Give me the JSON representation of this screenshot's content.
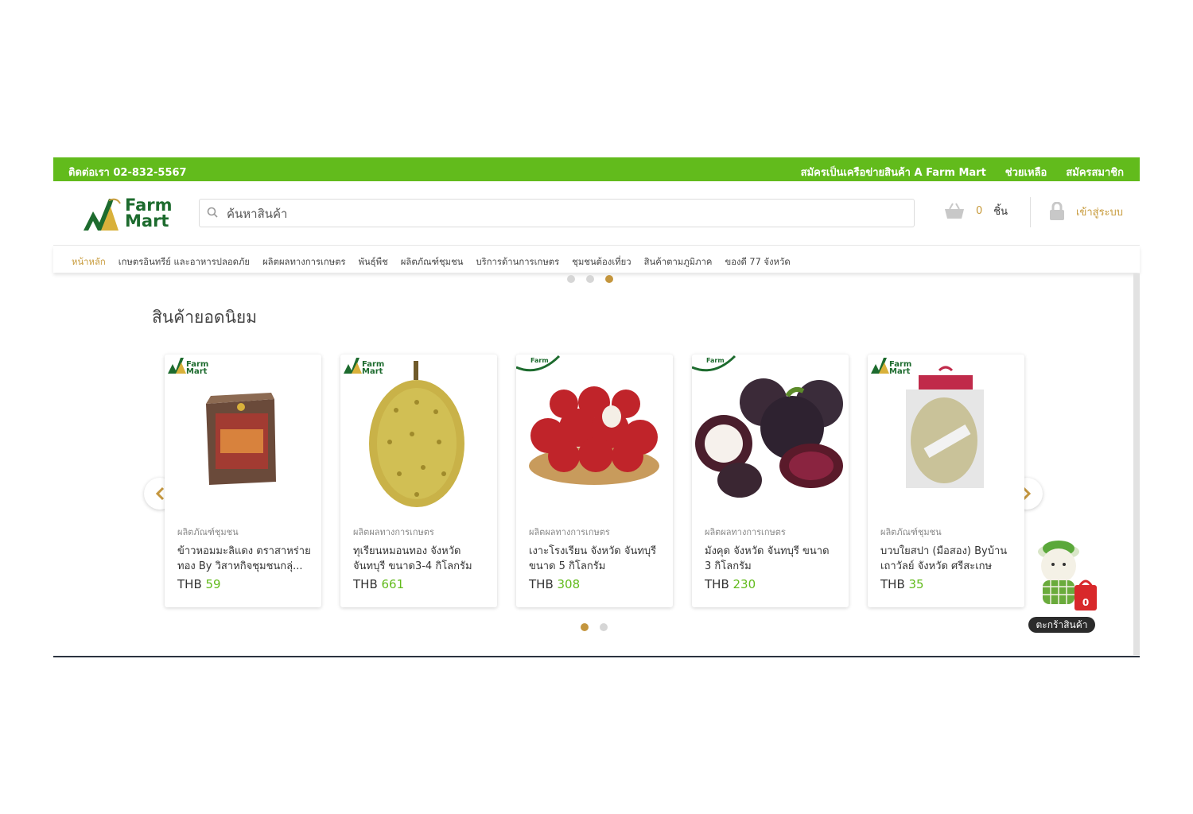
{
  "topbar": {
    "contact": "ติดต่อเรา 02-832-5567",
    "links": [
      "สมัครเป็นเครือข่ายสินค้า A Farm Mart",
      "ช่วยเหลือ",
      "สมัครสมาชิก"
    ]
  },
  "header": {
    "logo_line1": "Farm",
    "logo_line2": "Mart",
    "search_placeholder": "ค้นหาสินค้า",
    "cart_count": "0",
    "cart_unit": "ชิ้น",
    "login_label": "เข้าสู่ระบบ"
  },
  "nav": {
    "items": [
      "หน้าหลัก",
      "เกษตรอินทรีย์ และอาหารปลอดภัย",
      "ผลิตผลทางการเกษตร",
      "พันธุ์พืช",
      "ผลิตภัณฑ์ชุมชน",
      "บริการด้านการเกษตร",
      "ชุมชนต้องเที่ยว",
      "สินค้าตามภูมิภาค",
      "ของดี 77 จังหวัด"
    ]
  },
  "section": {
    "title": "สินค้ายอดนิยม"
  },
  "products": [
    {
      "category": "ผลิตภัณฑ์ชุมชน",
      "name": "ข้าวหอมมะลิแดง ตราสาหร่ายทอง By วิสาหกิจชุมชนกลุ่...",
      "currency": "THB",
      "price": "59"
    },
    {
      "category": "ผลิตผลทางการเกษตร",
      "name": "ทุเรียนหมอนทอง จังหวัดจันทบุรี ขนาด3-4 กิโลกรัม",
      "currency": "THB",
      "price": "661"
    },
    {
      "category": "ผลิตผลทางการเกษตร",
      "name": "เงาะโรงเรียน จังหวัด จันทบุรี ขนาด 5 กิโลกรัม",
      "currency": "THB",
      "price": "308"
    },
    {
      "category": "ผลิตผลทางการเกษตร",
      "name": "มังคุด จังหวัด จันทบุรี ขนาด 3 กิโลกรัม",
      "currency": "THB",
      "price": "230"
    },
    {
      "category": "ผลิตภัณฑ์ชุมชน",
      "name": "บวบใยสปา (มือสอง) Byบ้านเถาวัลย์ จังหวัด ศรีสะเกษ",
      "currency": "THB",
      "price": "35"
    }
  ],
  "floating_cart": {
    "count": "0",
    "label": "ตะกร้าสินค้า"
  },
  "colors": {
    "brand_green": "#62bb1c",
    "accent_gold": "#c4963e"
  }
}
